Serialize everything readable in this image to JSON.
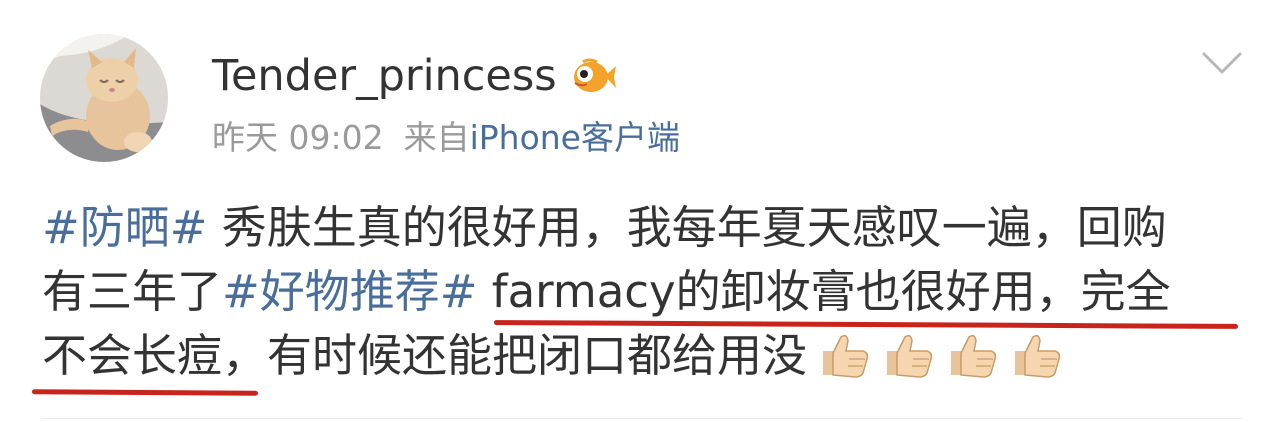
{
  "post": {
    "author": "Tender_princess",
    "verified_badge_icon": "fish-badge-icon",
    "time": "昨天 09:02",
    "source_prefix": "来自",
    "source": "iPhone客户端",
    "menu_icon": "chevron-down-icon",
    "content": {
      "tag1": "#防晒#",
      "text1": " 秀肤生真的很好用，我每年夏天感叹一遍，回购",
      "text2a": "有三年了",
      "tag2": "#好物推荐#",
      "text2b": " farmacy的卸妆膏也很好用，完全",
      "text3": "不会长痘，有时候还能把闭口都给用没",
      "emoji": [
        "thumbs-up-icon",
        "thumbs-up-icon",
        "thumbs-up-icon",
        "thumbs-up-icon"
      ]
    },
    "highlight_color": "#c8241c",
    "link_color": "#4a6e9c"
  }
}
